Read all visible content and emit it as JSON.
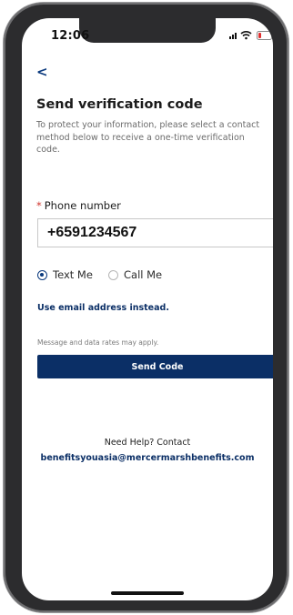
{
  "status_bar": {
    "time": "12:06"
  },
  "nav": {
    "back_glyph": "<"
  },
  "page": {
    "title": "Send verification code",
    "description": "To protect your information, please select a contact method below to receive a one-time verification code."
  },
  "phone_field": {
    "required_marker": "*",
    "label": "Phone number",
    "value": "+6591234567"
  },
  "contact_method": {
    "options": [
      {
        "label": "Text Me",
        "selected": true
      },
      {
        "label": "Call Me",
        "selected": false
      }
    ]
  },
  "alt_link": "Use email address instead.",
  "rates_note": "Message and data rates may apply.",
  "send_button_label": "Send Code",
  "help": {
    "text": "Need Help? Contact",
    "email": "benefitsyouasia@mercermarshbenefits.com"
  },
  "colors": {
    "primary": "#0b2f66",
    "required": "#d0342c"
  },
  "icons": [
    "back-chevron-icon",
    "signal-icon",
    "wifi-icon",
    "battery-icon"
  ]
}
